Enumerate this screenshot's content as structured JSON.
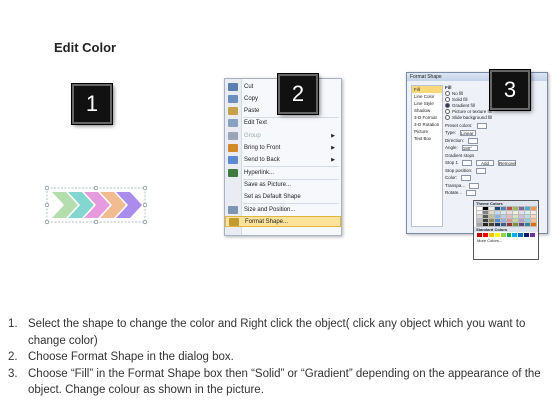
{
  "title": "Edit Color",
  "badges": [
    "1",
    "2",
    "3"
  ],
  "context_menu": {
    "items": [
      {
        "label": "Cut",
        "icon": "scissors-icon",
        "color": "#5a7fb0"
      },
      {
        "label": "Copy",
        "icon": "copy-icon",
        "color": "#6c8fbf"
      },
      {
        "label": "Paste",
        "icon": "paste-icon",
        "color": "#c9a14a"
      },
      {
        "label": "Edit Text",
        "icon": "edit-text-icon",
        "color": "#8aa0c0"
      },
      {
        "label": "Group",
        "icon": "group-icon",
        "color": "#9aa6b8",
        "disabled": true,
        "submenu": true
      },
      {
        "label": "Bring to Front",
        "icon": "bring-front-icon",
        "color": "#d08a2a",
        "submenu": true
      },
      {
        "label": "Send to Back",
        "icon": "send-back-icon",
        "color": "#5c8ad0",
        "submenu": true
      },
      {
        "label": "Hyperlink...",
        "icon": "hyperlink-icon",
        "color": "#3d7c3d"
      },
      {
        "label": "Save as Picture...",
        "icon": "",
        "color": ""
      },
      {
        "label": "Set as Default Shape",
        "icon": "",
        "color": ""
      },
      {
        "label": "Size and Position...",
        "icon": "size-position-icon",
        "color": "#7f93b3"
      },
      {
        "label": "Format Shape...",
        "icon": "format-shape-icon",
        "color": "#c29a2f",
        "highlighted": true
      }
    ]
  },
  "format_dialog": {
    "title": "Format Shape",
    "nav": [
      "Fill",
      "Line Color",
      "Line Style",
      "Shadow",
      "3-D Format",
      "3-D Rotation",
      "Picture",
      "Text Box"
    ],
    "pane_heading": "Fill",
    "options": [
      "No fill",
      "Solid fill",
      "Gradient fill",
      "Picture or texture fill",
      "Slide background fill"
    ],
    "selected_option": "Gradient fill",
    "fields": [
      {
        "label": "Preset colors:",
        "value": ""
      },
      {
        "label": "Type:",
        "value": "Linear"
      },
      {
        "label": "Direction:",
        "value": ""
      },
      {
        "label": "Angle:",
        "value": "180°"
      },
      {
        "label": "Gradient stops",
        "value": ""
      },
      {
        "label": "Stop 1",
        "value": ""
      },
      {
        "label": "Stop position:",
        "value": ""
      },
      {
        "label": "Color:",
        "value": ""
      },
      {
        "label": "Transpa...",
        "value": ""
      },
      {
        "label": "Rotate...",
        "value": ""
      }
    ],
    "add_label": "Add",
    "remove_label": "Remove"
  },
  "palette": {
    "theme_label": "Theme Colors",
    "theme_colors": [
      "#ffffff",
      "#000000",
      "#eeece1",
      "#1f497d",
      "#4f81bd",
      "#c0504d",
      "#9bbb59",
      "#8064a2",
      "#4bacc6",
      "#f79646",
      "#f2f2f2",
      "#7f7f7f",
      "#ddd9c3",
      "#c6d9f0",
      "#dbe5f1",
      "#f2dcdb",
      "#ebf1dd",
      "#e5e0ec",
      "#dbeef3",
      "#fdeada",
      "#d8d8d8",
      "#595959",
      "#c4bd97",
      "#8db3e2",
      "#b8cce4",
      "#e5b9b7",
      "#d7e3bc",
      "#ccc1d9",
      "#b7dde8",
      "#fbd5b5",
      "#bfbfbf",
      "#3f3f3f",
      "#938953",
      "#548dd4",
      "#95b3d7",
      "#d99694",
      "#c3d69b",
      "#b2a2c7",
      "#92cddc",
      "#fac08f",
      "#a5a5a5",
      "#262626",
      "#494429",
      "#17365d",
      "#366092",
      "#953734",
      "#76923c",
      "#5f497a",
      "#31859b",
      "#e36c09"
    ],
    "standard_label": "Standard Colors",
    "standard_colors": [
      "#c00000",
      "#ff0000",
      "#ffc000",
      "#ffff00",
      "#92d050",
      "#00b050",
      "#00b0f0",
      "#0070c0",
      "#002060",
      "#7030a0"
    ],
    "more_label": "More Colors..."
  },
  "arrow_colors": [
    "#a8d8a0",
    "#6fd0c8",
    "#e08ad8",
    "#f0b080",
    "#9a78e8"
  ],
  "steps": [
    {
      "num": "1.",
      "text": "Select the shape to change the color and Right click the object( click any object which you want to change color)"
    },
    {
      "num": "2.",
      "text": "Choose Format Shape in the dialog box."
    },
    {
      "num": "3.",
      "text": "Choose “Fill” in the Format Shape box then “Solid” or “Gradient” depending on the appearance of the object. Change colour as shown in the picture."
    }
  ]
}
